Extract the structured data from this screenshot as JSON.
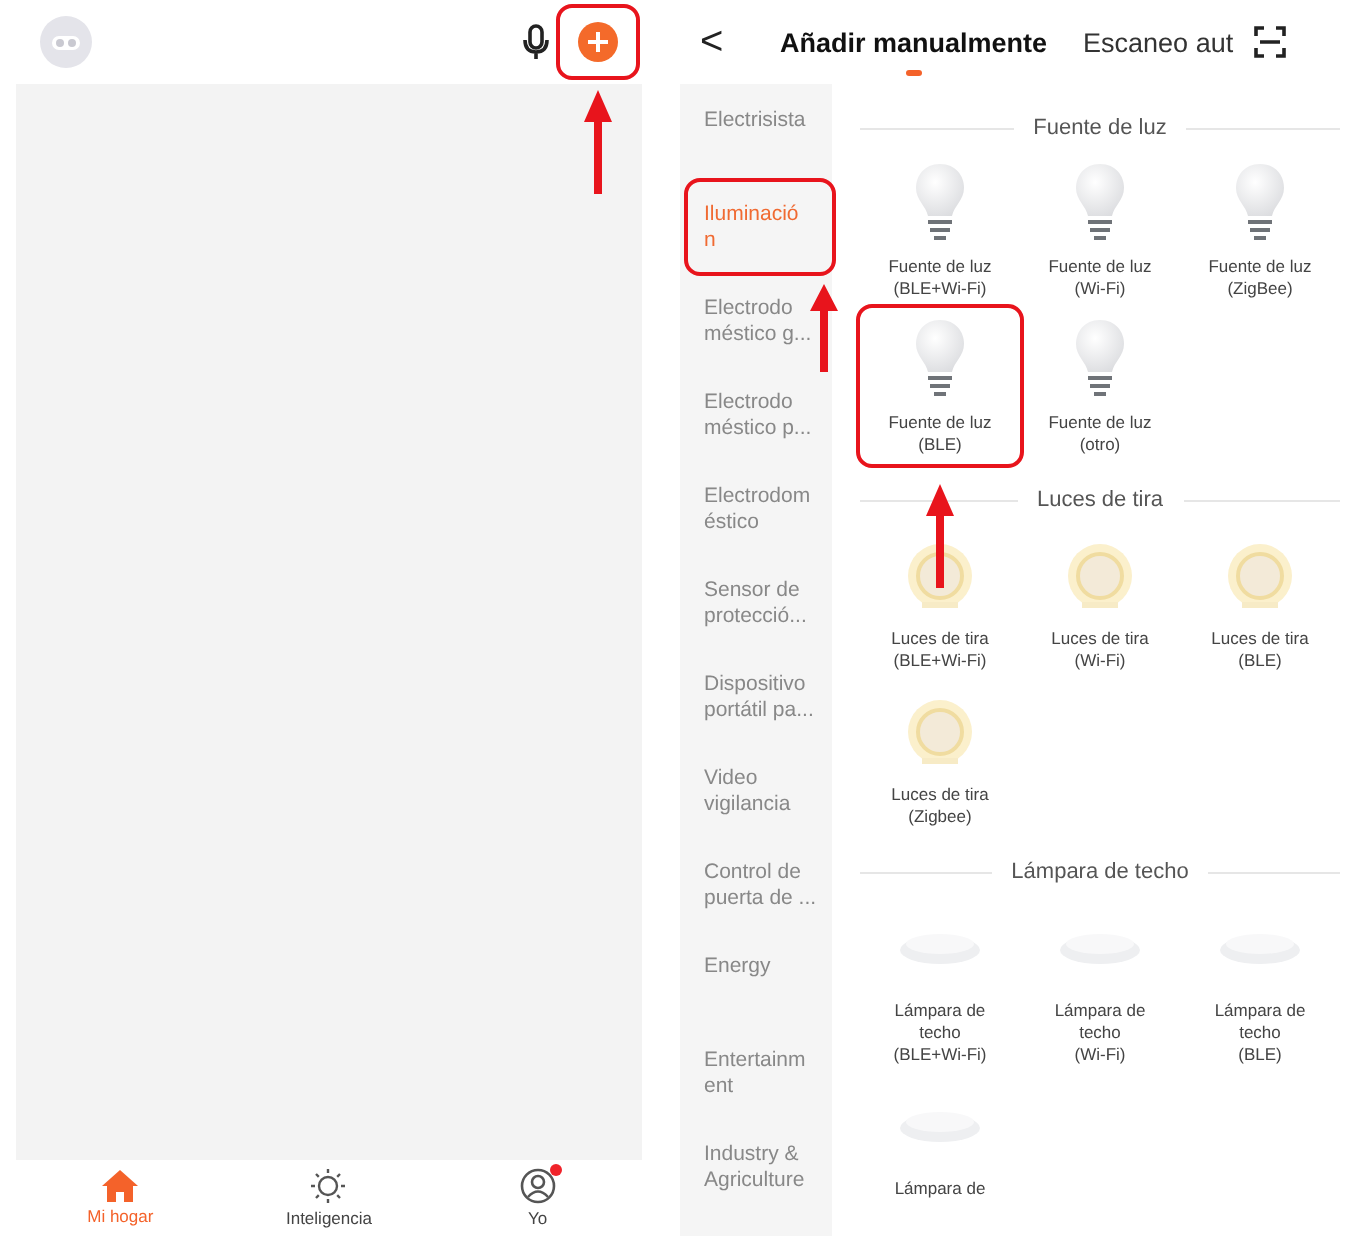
{
  "home_screen": {
    "avatar": {
      "kind": "robot"
    },
    "add_button": {
      "highlighted": true
    },
    "bottom_nav": [
      {
        "label": "Mi hogar",
        "selected": true,
        "badge": false
      },
      {
        "label": "Inteligencia",
        "selected": false,
        "badge": false
      },
      {
        "label": "Yo",
        "selected": false,
        "badge": true
      }
    ]
  },
  "add_device_screen": {
    "back": "<",
    "tabs": [
      {
        "label": "Añadir manualmente",
        "selected": true
      },
      {
        "label": "Escaneo aut",
        "selected": false
      }
    ],
    "sidebar": {
      "items": [
        {
          "label": "Electrisista",
          "selected": false,
          "highlighted": false
        },
        {
          "label": "Iluminació\nn",
          "selected": true,
          "highlighted": true
        },
        {
          "label": "Electrodo\nméstico g...",
          "selected": false,
          "highlighted": false
        },
        {
          "label": "Electrodo\nméstico p...",
          "selected": false,
          "highlighted": false
        },
        {
          "label": "Electrodom\néstico",
          "selected": false,
          "highlighted": false
        },
        {
          "label": "Sensor de\nprotecció...",
          "selected": false,
          "highlighted": false
        },
        {
          "label": "Dispositivo\nportátil pa...",
          "selected": false,
          "highlighted": false
        },
        {
          "label": "Video\nvigilancia",
          "selected": false,
          "highlighted": false
        },
        {
          "label": "Control de\npuerta de ...",
          "selected": false,
          "highlighted": false
        },
        {
          "label": "Energy",
          "selected": false,
          "highlighted": false
        },
        {
          "label": "Entertainm\nent",
          "selected": false,
          "highlighted": false
        },
        {
          "label": "Industry &\nAgriculture",
          "selected": false,
          "highlighted": false
        }
      ]
    },
    "sections": [
      {
        "title": "Fuente de luz",
        "items": [
          {
            "label": "Fuente de luz\n(BLE+Wi-Fi)",
            "kind": "bulb",
            "highlighted": false
          },
          {
            "label": "Fuente de luz\n(Wi-Fi)",
            "kind": "bulb",
            "highlighted": false
          },
          {
            "label": "Fuente de luz\n(ZigBee)",
            "kind": "bulb",
            "highlighted": false
          },
          {
            "label": "Fuente de luz\n(BLE)",
            "kind": "bulb",
            "highlighted": true
          },
          {
            "label": "Fuente de luz\n(otro)",
            "kind": "bulb",
            "highlighted": false
          }
        ]
      },
      {
        "title": "Luces de tira",
        "items": [
          {
            "label": "Luces de tira\n(BLE+Wi-Fi)",
            "kind": "strip",
            "highlighted": false
          },
          {
            "label": "Luces de tira\n(Wi-Fi)",
            "kind": "strip",
            "highlighted": false
          },
          {
            "label": "Luces de tira\n(BLE)",
            "kind": "strip",
            "highlighted": false
          },
          {
            "label": "Luces de tira\n(Zigbee)",
            "kind": "strip",
            "highlighted": false
          }
        ]
      },
      {
        "title": "Lámpara de techo",
        "items": [
          {
            "label": "Lámpara de\ntecho\n(BLE+Wi-Fi)",
            "kind": "ceiling",
            "highlighted": false
          },
          {
            "label": "Lámpara de\ntecho\n(Wi-Fi)",
            "kind": "ceiling",
            "highlighted": false
          },
          {
            "label": "Lámpara de\ntecho\n(BLE)",
            "kind": "ceiling",
            "highlighted": false
          },
          {
            "label": "Lámpara de",
            "kind": "ceiling",
            "highlighted": false
          }
        ]
      }
    ]
  }
}
